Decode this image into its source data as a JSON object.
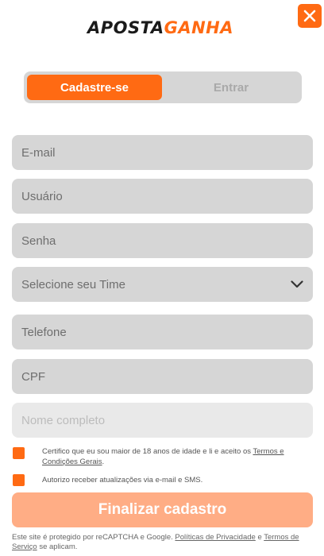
{
  "brand": {
    "part1": "APOSTA",
    "part2": "GANHA",
    "accent_color": "#ff6a13"
  },
  "close_icon": "close-icon",
  "tabs": [
    {
      "label": "Cadastre-se",
      "active": true
    },
    {
      "label": "Entrar",
      "active": false
    }
  ],
  "form": {
    "email_placeholder": "E-mail",
    "user_placeholder": "Usuário",
    "password_placeholder": "Senha",
    "team_select": "Selecione seu Time",
    "phone_placeholder": "Telefone",
    "cpf_placeholder": "CPF",
    "fullname_placeholder": "Nome completo"
  },
  "terms": {
    "text_before": "Certifico que eu sou maior de 18 anos de idade e li e aceito os ",
    "link": "Termos e Condições Gerais",
    "text_after": "."
  },
  "marketing": {
    "text": "Autorizo receber atualizações via e-mail e SMS."
  },
  "submit_label": "Finalizar cadastro",
  "footer": {
    "text1": "Este site é protegido por reCAPTCHA e Google. ",
    "privacy_link": "Políticas de Privacidade",
    "text2": " e ",
    "terms_link": "Termos de Serviço",
    "text3": " se aplicam."
  }
}
